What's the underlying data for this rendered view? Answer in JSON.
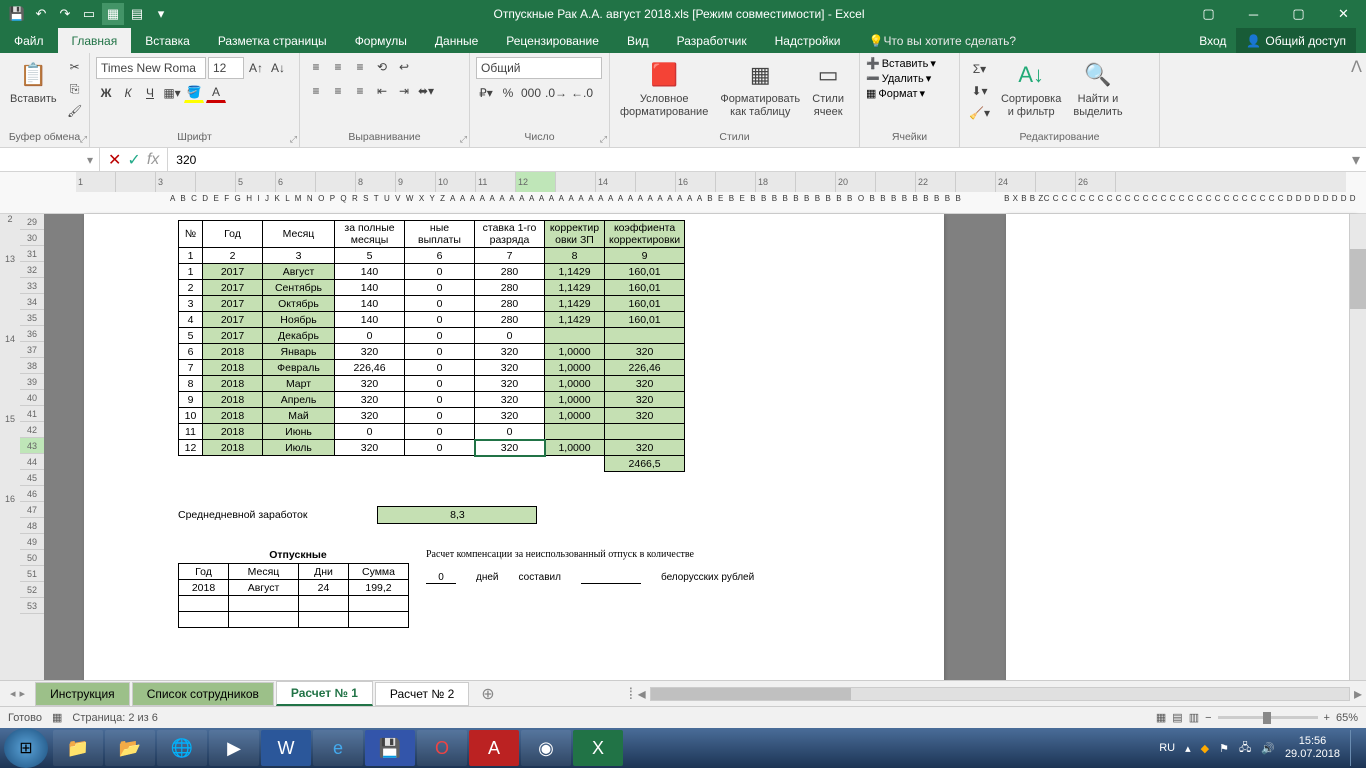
{
  "title": "Отпускные Рак А.А. август 2018.xls  [Режим совместимости] - Excel",
  "tabs": {
    "file": "Файл",
    "home": "Главная",
    "insert": "Вставка",
    "layout": "Разметка страницы",
    "formulas": "Формулы",
    "data": "Данные",
    "review": "Рецензирование",
    "view": "Вид",
    "developer": "Разработчик",
    "addins": "Надстройки",
    "tellme": "Что вы хотите сделать?",
    "signin": "Вход",
    "share": "Общий доступ"
  },
  "ribbon": {
    "clipboard": {
      "paste": "Вставить",
      "label": "Буфер обмена"
    },
    "font": {
      "name": "Times New Roma",
      "size": "12",
      "label": "Шрифт"
    },
    "align": {
      "label": "Выравнивание"
    },
    "number": {
      "format": "Общий",
      "label": "Число"
    },
    "styles": {
      "cond": "Условное\nформатирование",
      "table": "Форматировать\nкак таблицу",
      "cell": "Стили\nячеек",
      "label": "Стили"
    },
    "cells": {
      "insert": "Вставить",
      "delete": "Удалить",
      "format": "Формат",
      "label": "Ячейки"
    },
    "editing": {
      "sort": "Сортировка\nи фильтр",
      "find": "Найти и\nвыделить",
      "label": "Редактирование"
    }
  },
  "formula_bar": {
    "value": "320"
  },
  "rownums": [
    29,
    30,
    31,
    32,
    33,
    34,
    35,
    36,
    37,
    38,
    39,
    40,
    41,
    42,
    43,
    44,
    45,
    46,
    47,
    48,
    49,
    50,
    51,
    52,
    53
  ],
  "row_sel": 43,
  "ruler_left": [
    2,
    13,
    14,
    15,
    16
  ],
  "ruler_main_marks": [
    "1",
    "",
    "3",
    "",
    "5",
    "6",
    "",
    "8",
    "9",
    "10",
    "11",
    "12",
    "",
    "14",
    "",
    "16",
    "",
    "18",
    "",
    "20",
    "",
    "22",
    "",
    "24",
    "",
    "26"
  ],
  "col_letters": "A  B C D E F G H I J K L M N O P Q R S T U V W X Y Z A A A A A A A A A A A A A A A A A A A A A A A A A A B E B E B B B B B B B B B B O B B B B B B B B B",
  "col_letters_right": "B X B B ZC C C C C C C C C C C C C C C C C C C C C C C C C C C D D D D D D D D",
  "headers": {
    "num": "№",
    "year": "Год",
    "month": "Месяц",
    "full": "за полные\nмесяцы",
    "pay": "ные выплаты",
    "stavka": "ставка 1-го\nразряда",
    "korr": "корректир\nовки ЗП",
    "koef": "коэффиента\nкорректировки"
  },
  "headnums": [
    "1",
    "2",
    "3",
    "5",
    "6",
    "7",
    "8",
    "9"
  ],
  "rows": [
    {
      "n": "1",
      "y": "2017",
      "m": "Август",
      "c5": "140",
      "c6": "0",
      "c7": "280",
      "c8": "1,1429",
      "c9": "160,01"
    },
    {
      "n": "2",
      "y": "2017",
      "m": "Сентябрь",
      "c5": "140",
      "c6": "0",
      "c7": "280",
      "c8": "1,1429",
      "c9": "160,01"
    },
    {
      "n": "3",
      "y": "2017",
      "m": "Октябрь",
      "c5": "140",
      "c6": "0",
      "c7": "280",
      "c8": "1,1429",
      "c9": "160,01"
    },
    {
      "n": "4",
      "y": "2017",
      "m": "Ноябрь",
      "c5": "140",
      "c6": "0",
      "c7": "280",
      "c8": "1,1429",
      "c9": "160,01"
    },
    {
      "n": "5",
      "y": "2017",
      "m": "Декабрь",
      "c5": "0",
      "c6": "0",
      "c7": "0",
      "c8": "",
      "c9": ""
    },
    {
      "n": "6",
      "y": "2018",
      "m": "Январь",
      "c5": "320",
      "c6": "0",
      "c7": "320",
      "c8": "1,0000",
      "c9": "320"
    },
    {
      "n": "7",
      "y": "2018",
      "m": "Февраль",
      "c5": "226,46",
      "c6": "0",
      "c7": "320",
      "c8": "1,0000",
      "c9": "226,46"
    },
    {
      "n": "8",
      "y": "2018",
      "m": "Март",
      "c5": "320",
      "c6": "0",
      "c7": "320",
      "c8": "1,0000",
      "c9": "320"
    },
    {
      "n": "9",
      "y": "2018",
      "m": "Апрель",
      "c5": "320",
      "c6": "0",
      "c7": "320",
      "c8": "1,0000",
      "c9": "320"
    },
    {
      "n": "10",
      "y": "2018",
      "m": "Май",
      "c5": "320",
      "c6": "0",
      "c7": "320",
      "c8": "1,0000",
      "c9": "320"
    },
    {
      "n": "11",
      "y": "2018",
      "m": "Июнь",
      "c5": "0",
      "c6": "0",
      "c7": "0",
      "c8": "",
      "c9": ""
    },
    {
      "n": "12",
      "y": "2018",
      "m": "Июль",
      "c5": "320",
      "c6": "0",
      "c7": "320",
      "c8": "1,0000",
      "c9": "320"
    }
  ],
  "total": "2466,5",
  "daily": {
    "label": "Среднедневной заработок",
    "value": "8,3"
  },
  "vac": {
    "title": "Отпускные",
    "year": "Год",
    "month": "Месяц",
    "days": "Дни",
    "sum": "Сумма",
    "r_year": "2018",
    "r_month": "Август",
    "r_days": "24",
    "r_sum": "199,2"
  },
  "comp": {
    "line1": "Расчет компенсации за неиспользованный отпуск в количестве",
    "zero": "0",
    "days": "дней",
    "sost": "составил",
    "rub": "белорусских рублей"
  },
  "sheets": {
    "s1": "Инструкция",
    "s2": "Список сотрудников",
    "s3": "Расчет № 1",
    "s4": "Расчет № 2"
  },
  "status": {
    "ready": "Готово",
    "page": "Страница: 2 из 6",
    "zoom": "65%"
  },
  "tray": {
    "lang": "RU",
    "time": "15:56",
    "date": "29.07.2018"
  }
}
